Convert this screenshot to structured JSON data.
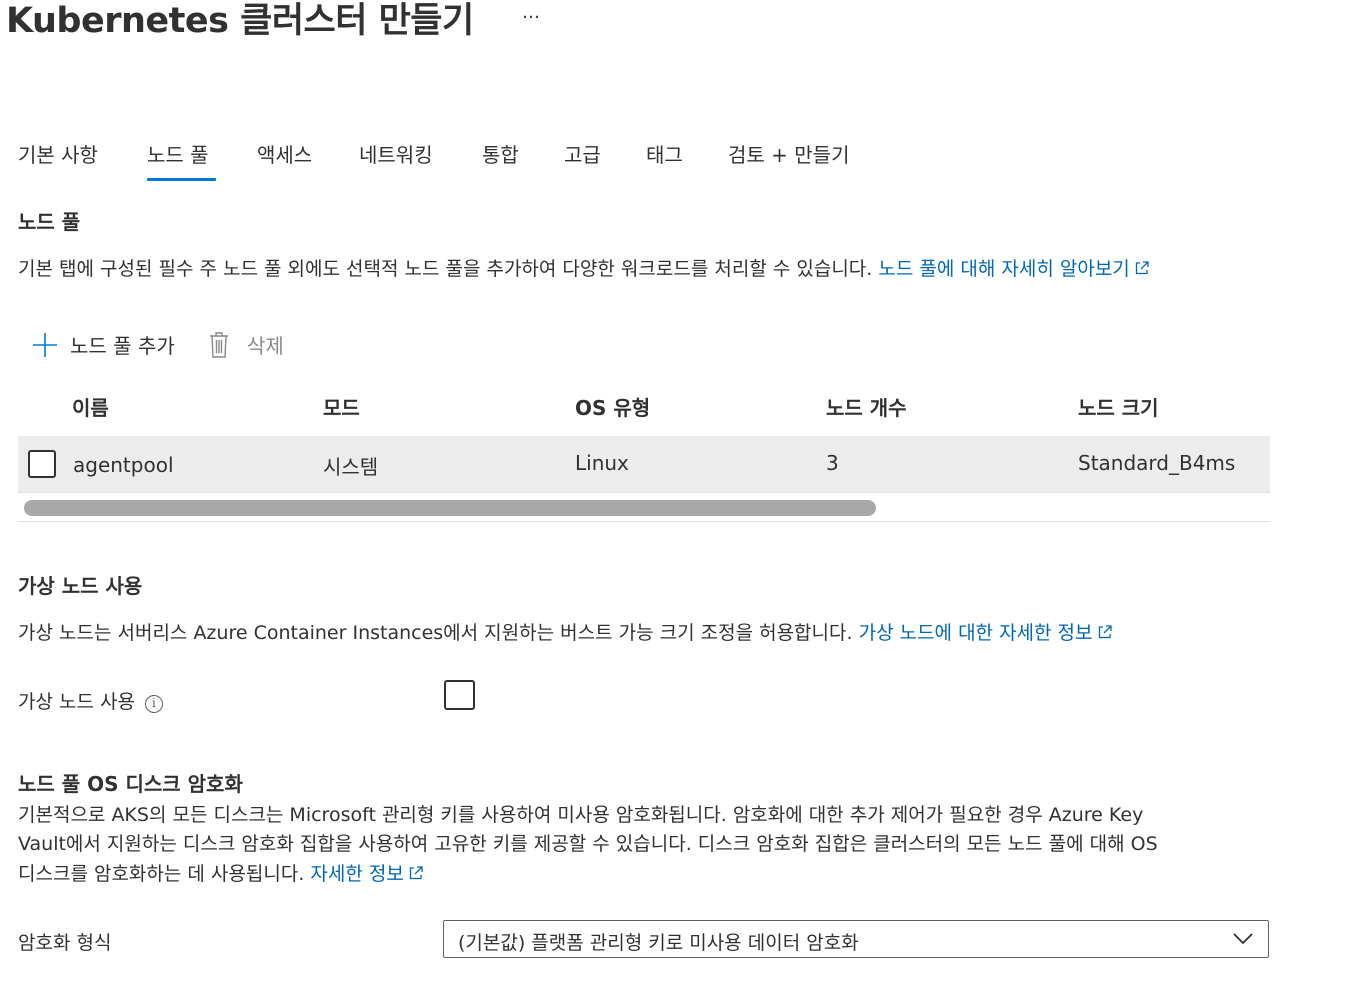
{
  "header": {
    "title": "Kubernetes 클러스터 만들기",
    "more_label": "…"
  },
  "tabs": [
    {
      "label": "기본 사항",
      "active": false
    },
    {
      "label": "노드 풀",
      "active": true
    },
    {
      "label": "액세스",
      "active": false
    },
    {
      "label": "네트워킹",
      "active": false
    },
    {
      "label": "통합",
      "active": false
    },
    {
      "label": "고급",
      "active": false
    },
    {
      "label": "태그",
      "active": false
    },
    {
      "label": "검토 + 만들기",
      "active": false
    }
  ],
  "node_pools": {
    "heading": "노드 풀",
    "description": "기본 탭에 구성된 필수 주 노드 풀 외에도 선택적 노드 풀을 추가하여 다양한 워크로드를 처리할 수 있습니다.",
    "learn_more": "노드 풀에 대해 자세히 알아보기",
    "add_label": "노드 풀 추가",
    "delete_label": "삭제",
    "columns": [
      "이름",
      "모드",
      "OS 유형",
      "노드 개수",
      "노드 크기"
    ],
    "rows": [
      {
        "name": "agentpool",
        "mode": "시스템",
        "os": "Linux",
        "count": "3",
        "size": "Standard_B4ms"
      }
    ]
  },
  "virtual_nodes": {
    "heading": "가상 노드 사용",
    "description": "가상 노드는 서버리스 Azure Container Instances에서 지원하는 버스트 가능 크기 조정을 허용합니다.",
    "learn_more": "가상 노드에 대한 자세한 정보",
    "field_label": "가상 노드 사용",
    "info_glyph": "i",
    "enabled": false
  },
  "encryption": {
    "heading": "노드 풀 OS 디스크 암호화",
    "line1": "기본적으로 AKS의 모든 디스크는 Microsoft 관리형 키를 사용하여 미사용 암호화됩니다. 암호화에 대한 추가 제어가 필요한 경우 Azure Key",
    "line2": "Vault에서 지원하는 디스크 암호화 집합을 사용하여 고유한 키를 제공할 수 있습니다. 디스크 암호화 집합은 클러스터의 모든 노드 풀에 대해 OS",
    "line3": "디스크를 암호화하는 데 사용됩니다.",
    "learn_more": "자세한 정보",
    "field_label": "암호화 형식",
    "selected": "(기본값) 플랫폼 관리형 키로 미사용 데이터 암호화"
  },
  "colors": {
    "accent": "#0078d4",
    "link": "#0067b8",
    "text": "#323130",
    "disabled": "#8a8886",
    "row_bg": "#ececec"
  },
  "icons": {
    "more": "ellipsis-icon",
    "add": "plus-icon",
    "delete": "trash-icon",
    "external": "external-link-icon",
    "info": "info-icon",
    "dropdown": "chevron-down-icon"
  }
}
